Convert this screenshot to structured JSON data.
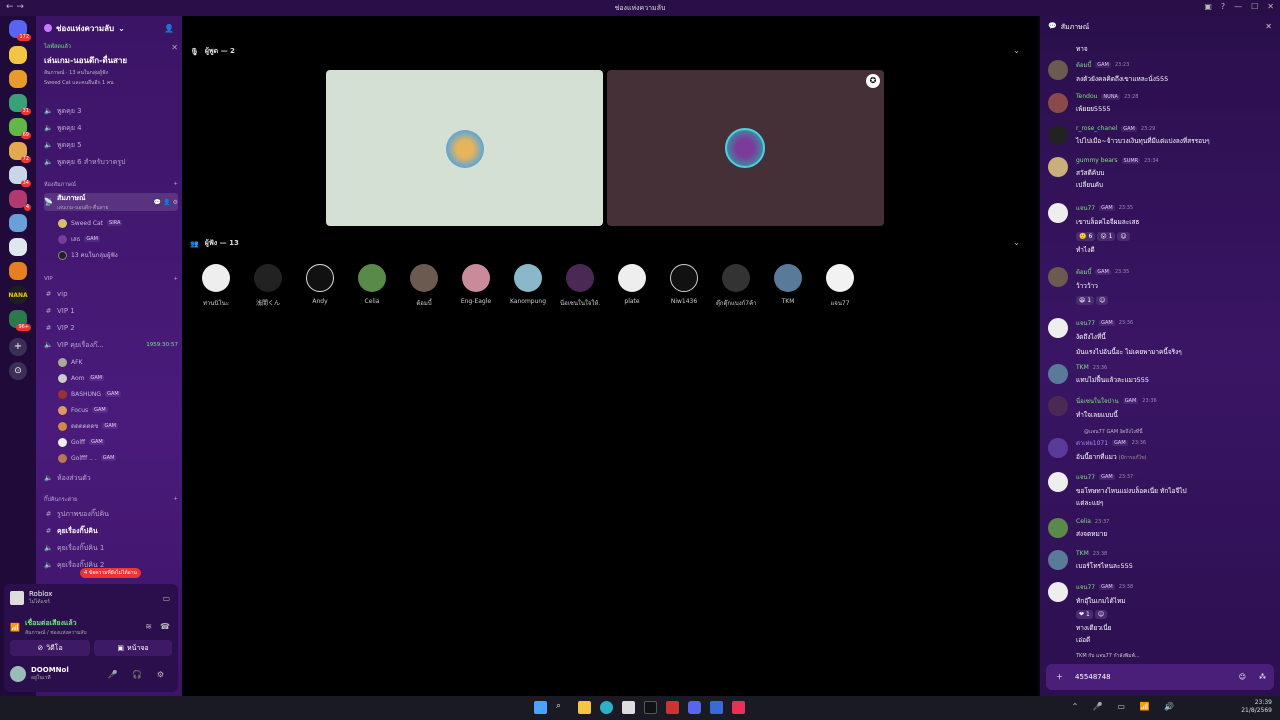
{
  "titlebar": {
    "title": "ช่องแห่งความลับ"
  },
  "guilds": {
    "badges": [
      "172",
      "31",
      "69",
      "72",
      "34",
      "4",
      "96+"
    ],
    "nana": "NANA"
  },
  "server": {
    "name": "ช่องแห่งความลับ",
    "event": {
      "label": "ไลฟ์สดแล้ว",
      "name": "เล่นเกม-นอนดึก-ตื่นสาย",
      "detail1": "สัมภาษณ์ · 13 คนในกลุ่มผู้ฟัง",
      "detail2": "Sweed Cat และคนอื่นอีก 1 คน"
    },
    "voice_top": [
      "พูดคุย 3",
      "พูดคุย 4",
      "พูดคุย 5",
      "พูดคุย 6 สำหรับวาดรูป"
    ],
    "cat_stage": "ห้องสัมภาษณ์",
    "stage_channel": {
      "name": "สัมภาษณ์",
      "sub": "เล่นเกม-นอนดึก-ตื่นสาย"
    },
    "stage_users": [
      {
        "name": "Sweed Cat",
        "tag": "SIRA"
      },
      {
        "name": "เสธ",
        "tag": "GAM"
      },
      {
        "name": "13 คนในกลุ่มผู้ฟัง",
        "tag": ""
      }
    ],
    "cat_vip": "VIP",
    "vip_channels": [
      "vip",
      "VIP 1",
      "VIP 2"
    ],
    "vip_voice": {
      "name": "VIP คุยเรื่องก๊...",
      "timer": "1959:30:57"
    },
    "vip_users": [
      {
        "name": "AFK",
        "tag": ""
      },
      {
        "name": "Aom",
        "tag": "GAM"
      },
      {
        "name": "BASHUNG",
        "tag": "GAM"
      },
      {
        "name": "Focus",
        "tag": "GAM"
      },
      {
        "name": "ดดดดดดข",
        "tag": "GAM"
      },
      {
        "name": "Golff",
        "tag": "GAM"
      },
      {
        "name": "Golfff .. .",
        "tag": "GAM"
      }
    ],
    "private_room": "ห้องส่วนตัว",
    "cat_gang": "กิ๊ปคินกระต่าย",
    "gang_channels": [
      "รูปภาพของกิ๊ปคิน",
      "คุยเรื่องกิ๊ปคิน",
      "คุยเรื่องกิ๊ปคิน 1",
      "คุยเรื่องกิ๊ปคิน 2"
    ],
    "new_msgs": "4 ข้อความที่ยังไม่ได้อ่าน"
  },
  "activity": {
    "game": "Roblox",
    "sub": "ไม่ได้แชร์"
  },
  "voice": {
    "status": "เชื่อมต่อเสียงแล้ว",
    "channel": "สัมภาษณ์ / ช่องแห่งความลับ",
    "video": "วิดีโอ",
    "screen": "หน้าจอ"
  },
  "me": {
    "name": "DOOMNol",
    "status": "อยู่ในเวที"
  },
  "stage": {
    "speakers_label": "ผู้พูด — 2",
    "audience_label": "ผู้ฟัง — 13",
    "audience": [
      "ท่านนิโนะ",
      "浅間くん",
      "Andy",
      "Celia",
      "ต้อมบี้",
      "Eng-Eagle",
      "Kanompung",
      "นี่อเซนในใจให้...",
      "plate",
      "Niw1436",
      "ตุ๊กตุ๊กแบงก์7ค้า...",
      "TKM",
      "แจน77"
    ]
  },
  "chat": {
    "header": "สัมภาษณ์",
    "messages": [
      {
        "body": "ทาจ"
      },
      {
        "name": "ต้อมบี้",
        "tag": "GAM",
        "time": "23:23",
        "body": "ลงตัวยังคลคิดถึงเขาแหละนั่ง555"
      },
      {
        "name": "Tendou",
        "tag": "NUNA",
        "time": "23:28",
        "body": "เพ้ยยย5555"
      },
      {
        "name": "r_rose_chanel",
        "tag": "GAM",
        "time": "23:29",
        "body": "ไปไปเมือ~จ้าวบวงเงินทุนที่มีแต่แบ่งลงที่สรรอบๆ"
      },
      {
        "name": "gummy bears",
        "tag": "SUMR",
        "time": "23:34",
        "body": "สวัสดีค้บบ",
        "body2": "เปลี่ยนคับ"
      },
      {
        "name": "แจน77",
        "tag": "GAM",
        "time": "23:35",
        "body": "เขาบล็อคไอจีผมละเสธ",
        "r1": "6",
        "r2": "1",
        "body2": "ทำไงดี"
      },
      {
        "name": "ต้อมบี้",
        "tag": "GAM",
        "time": "23:35",
        "body": "ว้าวว้าว",
        "r1": "1"
      },
      {
        "name": "แจน77",
        "tag": "GAM",
        "time": "23:36",
        "body": "งัดถึงไงที่นี้",
        "body2": "มันแรงไปอันนี้อะ ไม่เคยพามาคนี้จริงๆ"
      },
      {
        "name": "TKM",
        "time": "23:36",
        "body": "แทบไม่ฟื้นแล้วละแมว555"
      },
      {
        "name": "นี่อเซนในใจป่าน",
        "tag": "GAM",
        "time": "23:36",
        "body": "ทำใจเลยแบบนี้"
      },
      {
        "reply": "@แจน77 GAM งัดถึงไงที่นี้",
        "name": "ต่าเห่ย1071",
        "tag": "GAM",
        "time": "23:36",
        "body": "อันนี้ยากที่แมว",
        "edited": "(มีการแก้ไข)"
      },
      {
        "name": "แจน77",
        "tag": "GAM",
        "time": "23:37",
        "body": "ขอโทษทางไหนแม่งบล็อคเนี่ย ทักไอจีไป",
        "body2": "แต่ละแย่ๆ"
      },
      {
        "name": "Celia",
        "time": "23:37",
        "body": "ส่งจดหมาย"
      },
      {
        "name": "TKM",
        "time": "23:38",
        "body": "เบอร์โทรไหนละ555"
      },
      {
        "name": "แจน77",
        "tag": "GAM",
        "time": "23:38",
        "body": "ทักอุ๊ในเกมได้ไหม",
        "r1": "1",
        "body2": "ทางเดียวเนี่ย",
        "body3": "เอ่อดี"
      },
      {
        "typing": "TKM กับ แจน77 กำลังพิมพ์..."
      }
    ],
    "composer_value": "45548748"
  },
  "taskbar": {
    "time": "23:39",
    "date": "21/8/2569"
  }
}
